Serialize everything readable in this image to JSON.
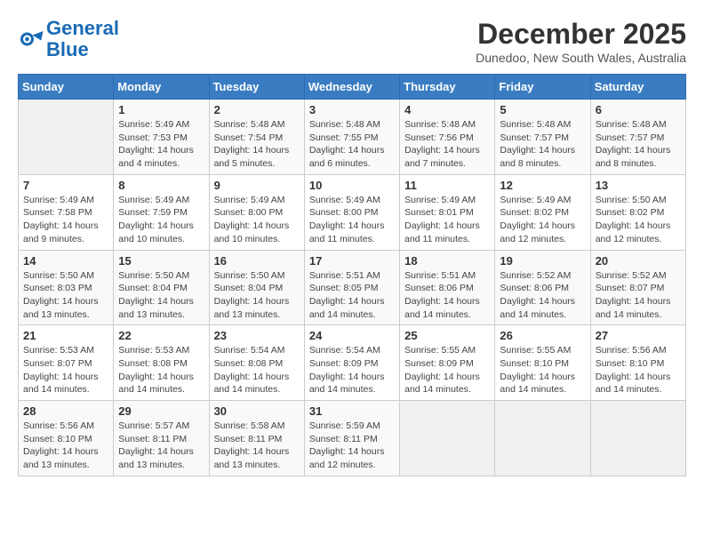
{
  "header": {
    "logo_line1": "General",
    "logo_line2": "Blue",
    "month_title": "December 2025",
    "location": "Dunedoo, New South Wales, Australia"
  },
  "days_of_week": [
    "Sunday",
    "Monday",
    "Tuesday",
    "Wednesday",
    "Thursday",
    "Friday",
    "Saturday"
  ],
  "weeks": [
    [
      {
        "day": "",
        "info": ""
      },
      {
        "day": "1",
        "info": "Sunrise: 5:49 AM\nSunset: 7:53 PM\nDaylight: 14 hours\nand 4 minutes."
      },
      {
        "day": "2",
        "info": "Sunrise: 5:48 AM\nSunset: 7:54 PM\nDaylight: 14 hours\nand 5 minutes."
      },
      {
        "day": "3",
        "info": "Sunrise: 5:48 AM\nSunset: 7:55 PM\nDaylight: 14 hours\nand 6 minutes."
      },
      {
        "day": "4",
        "info": "Sunrise: 5:48 AM\nSunset: 7:56 PM\nDaylight: 14 hours\nand 7 minutes."
      },
      {
        "day": "5",
        "info": "Sunrise: 5:48 AM\nSunset: 7:57 PM\nDaylight: 14 hours\nand 8 minutes."
      },
      {
        "day": "6",
        "info": "Sunrise: 5:48 AM\nSunset: 7:57 PM\nDaylight: 14 hours\nand 8 minutes."
      }
    ],
    [
      {
        "day": "7",
        "info": "Sunrise: 5:49 AM\nSunset: 7:58 PM\nDaylight: 14 hours\nand 9 minutes."
      },
      {
        "day": "8",
        "info": "Sunrise: 5:49 AM\nSunset: 7:59 PM\nDaylight: 14 hours\nand 10 minutes."
      },
      {
        "day": "9",
        "info": "Sunrise: 5:49 AM\nSunset: 8:00 PM\nDaylight: 14 hours\nand 10 minutes."
      },
      {
        "day": "10",
        "info": "Sunrise: 5:49 AM\nSunset: 8:00 PM\nDaylight: 14 hours\nand 11 minutes."
      },
      {
        "day": "11",
        "info": "Sunrise: 5:49 AM\nSunset: 8:01 PM\nDaylight: 14 hours\nand 11 minutes."
      },
      {
        "day": "12",
        "info": "Sunrise: 5:49 AM\nSunset: 8:02 PM\nDaylight: 14 hours\nand 12 minutes."
      },
      {
        "day": "13",
        "info": "Sunrise: 5:50 AM\nSunset: 8:02 PM\nDaylight: 14 hours\nand 12 minutes."
      }
    ],
    [
      {
        "day": "14",
        "info": "Sunrise: 5:50 AM\nSunset: 8:03 PM\nDaylight: 14 hours\nand 13 minutes."
      },
      {
        "day": "15",
        "info": "Sunrise: 5:50 AM\nSunset: 8:04 PM\nDaylight: 14 hours\nand 13 minutes."
      },
      {
        "day": "16",
        "info": "Sunrise: 5:50 AM\nSunset: 8:04 PM\nDaylight: 14 hours\nand 13 minutes."
      },
      {
        "day": "17",
        "info": "Sunrise: 5:51 AM\nSunset: 8:05 PM\nDaylight: 14 hours\nand 14 minutes."
      },
      {
        "day": "18",
        "info": "Sunrise: 5:51 AM\nSunset: 8:06 PM\nDaylight: 14 hours\nand 14 minutes."
      },
      {
        "day": "19",
        "info": "Sunrise: 5:52 AM\nSunset: 8:06 PM\nDaylight: 14 hours\nand 14 minutes."
      },
      {
        "day": "20",
        "info": "Sunrise: 5:52 AM\nSunset: 8:07 PM\nDaylight: 14 hours\nand 14 minutes."
      }
    ],
    [
      {
        "day": "21",
        "info": "Sunrise: 5:53 AM\nSunset: 8:07 PM\nDaylight: 14 hours\nand 14 minutes."
      },
      {
        "day": "22",
        "info": "Sunrise: 5:53 AM\nSunset: 8:08 PM\nDaylight: 14 hours\nand 14 minutes."
      },
      {
        "day": "23",
        "info": "Sunrise: 5:54 AM\nSunset: 8:08 PM\nDaylight: 14 hours\nand 14 minutes."
      },
      {
        "day": "24",
        "info": "Sunrise: 5:54 AM\nSunset: 8:09 PM\nDaylight: 14 hours\nand 14 minutes."
      },
      {
        "day": "25",
        "info": "Sunrise: 5:55 AM\nSunset: 8:09 PM\nDaylight: 14 hours\nand 14 minutes."
      },
      {
        "day": "26",
        "info": "Sunrise: 5:55 AM\nSunset: 8:10 PM\nDaylight: 14 hours\nand 14 minutes."
      },
      {
        "day": "27",
        "info": "Sunrise: 5:56 AM\nSunset: 8:10 PM\nDaylight: 14 hours\nand 14 minutes."
      }
    ],
    [
      {
        "day": "28",
        "info": "Sunrise: 5:56 AM\nSunset: 8:10 PM\nDaylight: 14 hours\nand 13 minutes."
      },
      {
        "day": "29",
        "info": "Sunrise: 5:57 AM\nSunset: 8:11 PM\nDaylight: 14 hours\nand 13 minutes."
      },
      {
        "day": "30",
        "info": "Sunrise: 5:58 AM\nSunset: 8:11 PM\nDaylight: 14 hours\nand 13 minutes."
      },
      {
        "day": "31",
        "info": "Sunrise: 5:59 AM\nSunset: 8:11 PM\nDaylight: 14 hours\nand 12 minutes."
      },
      {
        "day": "",
        "info": ""
      },
      {
        "day": "",
        "info": ""
      },
      {
        "day": "",
        "info": ""
      }
    ]
  ]
}
